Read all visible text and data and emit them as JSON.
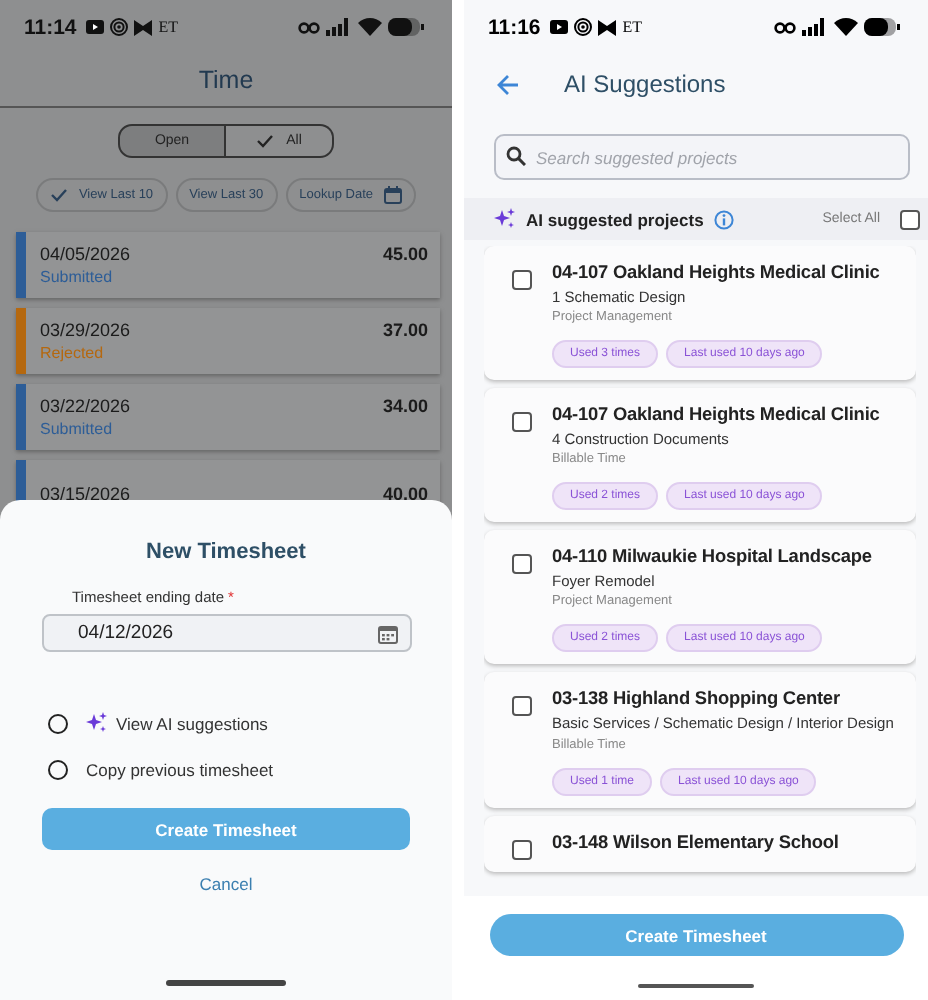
{
  "time_screen": {
    "status_bar": {
      "time": "11:14",
      "notification": "ET"
    },
    "title": "Time",
    "filter": [
      {
        "label": "Open",
        "selected": false
      },
      {
        "label": "All",
        "selected": true
      }
    ],
    "chips": [
      {
        "label": "View Last 10",
        "kind": "toggle",
        "checked": true
      },
      {
        "label": "View Last 30",
        "kind": "toggle",
        "checked": false
      },
      {
        "label": "Lookup Date",
        "kind": "date",
        "checked": false
      }
    ],
    "timesheets": [
      {
        "date": "04/05/2026",
        "hours": "45.00",
        "status": "Submitted",
        "color": "#2d5d97"
      },
      {
        "date": "03/29/2026",
        "hours": "37.00",
        "status": "Rejected",
        "color": "#b5680f"
      },
      {
        "date": "03/22/2026",
        "hours": "34.00",
        "status": "Submitted",
        "color": "#2d5d97"
      },
      {
        "date": "03/15/2026",
        "hours": "40.00",
        "color": "#2d5d97"
      }
    ]
  },
  "new_timesheet": {
    "title": "New Timesheet",
    "date_label": "Timesheet ending date",
    "required_mark": "*",
    "date_value": "04/12/2026",
    "options": [
      {
        "label": "View AI suggestions",
        "kind": "ai",
        "selected": false
      },
      {
        "label": "Copy previous timesheet",
        "kind": "plain",
        "selected": false
      }
    ],
    "create_button": "Create Timesheet",
    "cancel_button": "Cancel"
  },
  "ai_screen": {
    "status_bar": {
      "time": "11:16",
      "notification": "ET"
    },
    "title": "AI Suggestions",
    "search": {
      "placeholder": "Search suggested projects"
    },
    "section_title": "AI suggested projects",
    "select_all": {
      "label": "Select All",
      "checked": false
    },
    "suggestions": [
      {
        "project": "04-107 Oakland Heights Medical Clinic",
        "phase": "1 Schematic Design",
        "activity": "Project Management",
        "usage": "Used 3 times",
        "last_used": "Last used 10 days ago",
        "checked": false
      },
      {
        "project": "04-107 Oakland Heights Medical Clinic",
        "phase": "4 Construction Documents",
        "activity": "Billable Time",
        "usage": "Used 2 times",
        "last_used": "Last used 10 days ago",
        "checked": false
      },
      {
        "project": "04-110 Milwaukie Hospital Landscape",
        "phase": "Foyer Remodel",
        "activity": "Project Management",
        "usage": "Used 2 times",
        "last_used": "Last used 10 days ago",
        "checked": false
      },
      {
        "project": "03-138 Highland Shopping Center",
        "phase": "Basic Services / Schematic Design / Interior Design",
        "activity": "Billable Time",
        "usage": "Used 1 time",
        "last_used": "Last used 10 days ago",
        "checked": false
      },
      {
        "project": "03-148 Wilson Elementary School",
        "checked": false
      }
    ],
    "create_button": "Create Timesheet"
  }
}
